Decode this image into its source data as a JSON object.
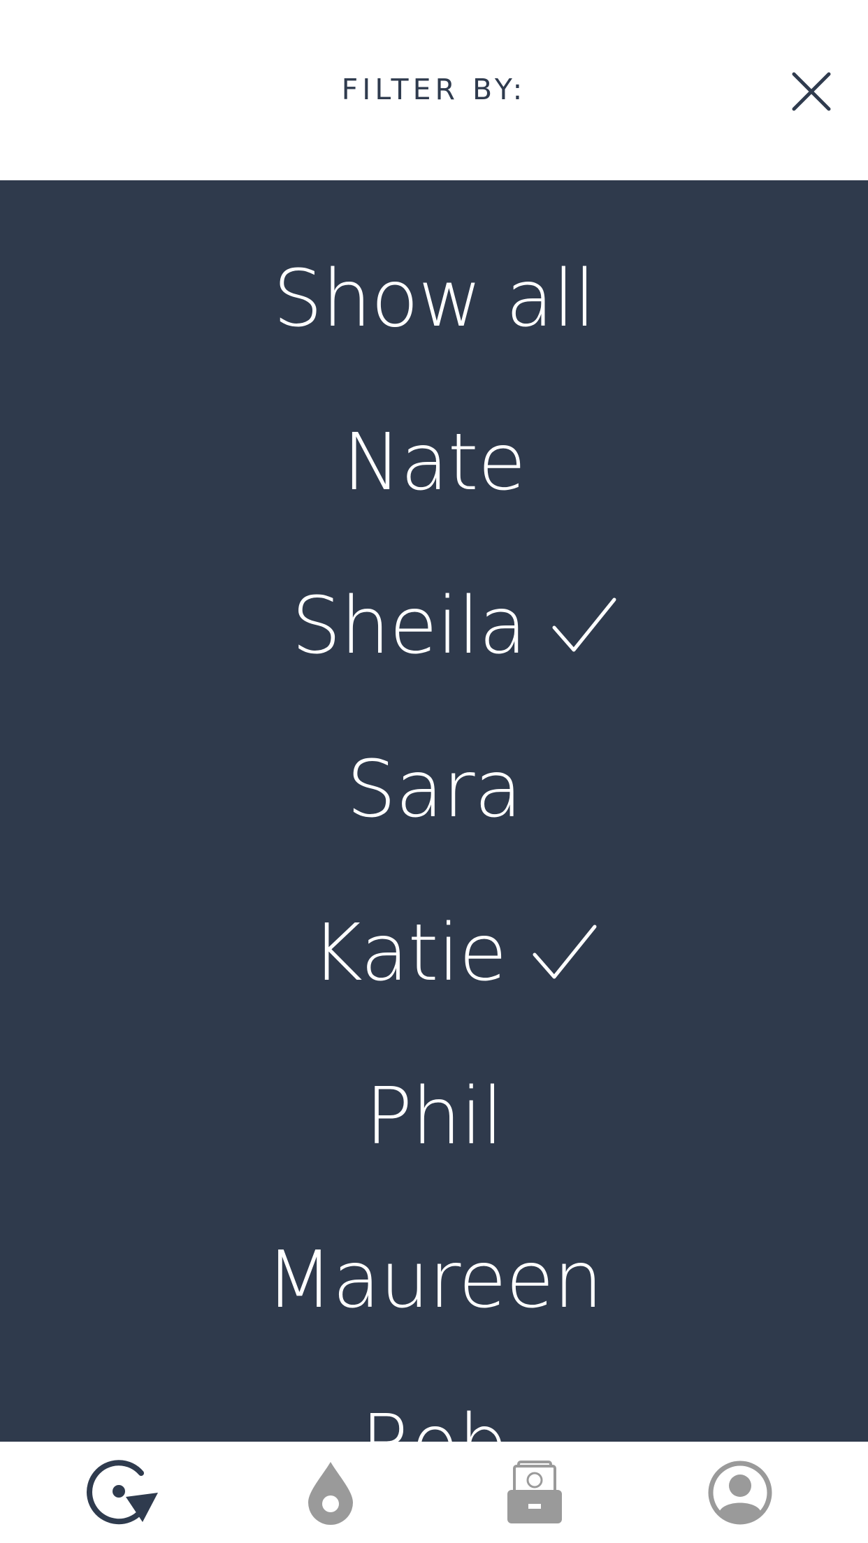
{
  "header": {
    "title": "FILTER BY:",
    "close_icon": "close-icon"
  },
  "filters": [
    {
      "label": "Show all",
      "checked": false
    },
    {
      "label": "Nate",
      "checked": false
    },
    {
      "label": "Sheila",
      "checked": true
    },
    {
      "label": "Sara",
      "checked": false
    },
    {
      "label": "Katie",
      "checked": true
    },
    {
      "label": "Phil",
      "checked": false
    },
    {
      "label": "Maureen",
      "checked": false
    },
    {
      "label": "Rob",
      "checked": false
    }
  ],
  "tabs": [
    {
      "icon": "refresh-cycle-icon",
      "active": true
    },
    {
      "icon": "drop-location-icon",
      "active": false
    },
    {
      "icon": "cash-register-icon",
      "active": false
    },
    {
      "icon": "profile-icon",
      "active": false
    }
  ],
  "colors": {
    "panel": "#2f3a4c",
    "accent": "#2f3b4e",
    "inactive_icon": "#9a9a9a",
    "text_on_panel": "#ffffff"
  }
}
